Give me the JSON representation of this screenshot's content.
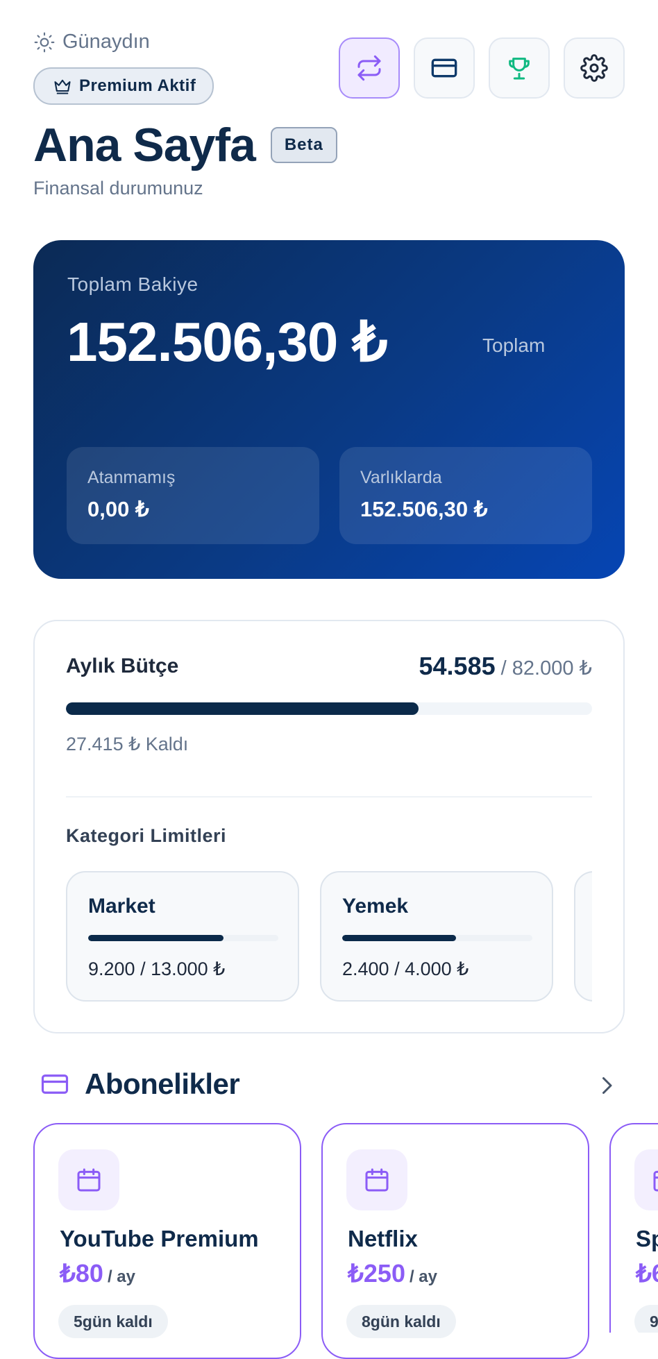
{
  "header": {
    "greeting": "Günaydın",
    "premium_label": "Premium Aktif",
    "title": "Ana Sayfa",
    "badge": "Beta",
    "subtitle": "Finansal durumunuz"
  },
  "toolbar": {
    "buttons": [
      {
        "icon": "transfer-icon",
        "active": true
      },
      {
        "icon": "credit-card-icon",
        "active": false
      },
      {
        "icon": "trophy-icon",
        "active": false
      },
      {
        "icon": "gear-icon",
        "active": false
      }
    ]
  },
  "balance": {
    "label": "Toplam Bakiye",
    "amount": "152.506,30 ₺",
    "total_label": "Toplam",
    "unassigned_label": "Atanmamış",
    "unassigned_value": "0,00 ₺",
    "assets_label": "Varlıklarda",
    "assets_value": "152.506,30 ₺"
  },
  "budget": {
    "title": "Aylık Bütçe",
    "spent": "54.585",
    "limit": "/ 82.000 ₺",
    "progress": 0.67,
    "remaining": "27.415 ₺ Kaldı",
    "categories_title": "Kategori Limitleri",
    "categories": [
      {
        "name": "Market",
        "amount": "9.200 / 13.000 ₺",
        "progress": 0.71
      },
      {
        "name": "Yemek",
        "amount": "2.400 / 4.000 ₺",
        "progress": 0.6
      },
      {
        "name": "",
        "amount": "",
        "progress": 0
      }
    ]
  },
  "subscriptions": {
    "title": "Abonelikler",
    "items": [
      {
        "name": "YouTube Premium",
        "price": "₺80",
        "period": "/ ay",
        "days": "5gün kaldı"
      },
      {
        "name": "Netflix",
        "price": "₺250",
        "period": "/ ay",
        "days": "8gün kaldı"
      },
      {
        "name": "Sp",
        "price": "₺6",
        "period": "",
        "days": "9"
      }
    ]
  },
  "colors": {
    "accent": "#8b5cf6",
    "navy": "#0f2a4a",
    "trophy": "#10b981",
    "card_gradient_start": "#0b2a55",
    "card_gradient_end": "#0645b3"
  }
}
